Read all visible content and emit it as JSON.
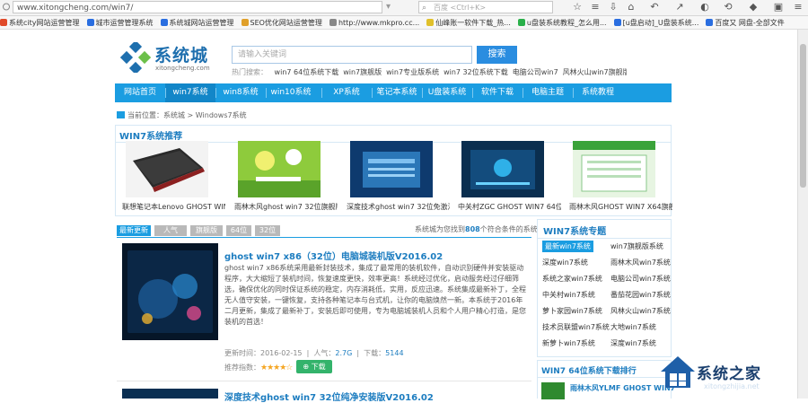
{
  "browser": {
    "url": "www.xitongcheng.com/win7/",
    "search_placeholder": "百度 <Ctrl+K>",
    "bookmarks": [
      {
        "label": "系统city网站运营管理",
        "color": "#e04a2a"
      },
      {
        "label": "城市运营管理系统",
        "color": "#2a6ee0"
      },
      {
        "label": "系统城网站运营管理",
        "color": "#2a6ee0"
      },
      {
        "label": "SEO优化网站运营管理",
        "color": "#e0a02a"
      },
      {
        "label": "http://www.mkpro.cc...",
        "color": "#888888"
      },
      {
        "label": "仙峰账一软件下载_热...",
        "color": "#e0c02a"
      },
      {
        "label": "u盘装系统教程_怎么用...",
        "color": "#2ab04a"
      },
      {
        "label": "[u盘启动]_U盘装系统...",
        "color": "#2a6ee0"
      },
      {
        "label": "百度又 网盘-全部文件",
        "color": "#2a6ee0"
      }
    ]
  },
  "header": {
    "logo_name": "系统城",
    "logo_sub": "xitongcheng.com",
    "search_placeholder": "请输入关键词",
    "search_button": "搜索",
    "hot_label": "热门搜索：",
    "hot_items": [
      "win7 64位系统下载",
      "win7旗舰版",
      "win7专业版系统",
      "win7 32位系统下载",
      "电脑公司win7",
      "风林火山win7旗舰版"
    ]
  },
  "nav": [
    "网站首页",
    "win7系统",
    "win8系统",
    "win10系统",
    "XP系统",
    "笔记本系统",
    "U盘装系统",
    "软件下载",
    "电脑主题",
    "系统教程",
    "系统教程"
  ],
  "breadcrumb": "当前位置：系统城 > Windows7系统",
  "recommend": {
    "title": "WIN7系统推荐",
    "items": [
      "联想笔记本Lenovo GHOST WIN7",
      "雨林木风ghost win7 32位旗舰版",
      "深度技术ghost win7 32位免激活版",
      "中关村ZGC GHOST WIN7 64位",
      "雨林木风GHOST WIN7 X64旗舰版"
    ]
  },
  "tabs": [
    "最新更新",
    "人气",
    "旗舰版",
    "64位",
    "32位"
  ],
  "count": {
    "prefix": "系统城为您找到",
    "number": "808",
    "suffix": "个符合条件的系统"
  },
  "article": {
    "title": "ghost win7 x86（32位）电脑城装机版V2016.02",
    "desc": "ghost win7 x86系统采用最新封装技术，集成了最常用的装机软件，自动识别硬件并安装驱动程序，大大缩短了装机时间，恢复速度更快，效率更高！系统经过优化，启动服务经过仔细筛选，确保优化的同时保证系统的稳定，内存消耗低，实用，反应迅速。系统集成最新补丁，全程无人值守安装，一键恢复，支持各种笔记本与台式机，让你的电脑焕然一新。本系统于2016年二月更新，集成了最新补丁，安装后即可使用，专为电脑城装机人员和个人用户精心打造，是您装机的首选！",
    "meta_prefix": "更新时间：",
    "date": "2016-02-15",
    "size_label": "人气：",
    "size": "2.7G",
    "downloads_label": "下载：",
    "downloads": "5144",
    "rating_label": "推荐指数：",
    "stars": "★★★★☆",
    "download_button": "下载"
  },
  "article2": {
    "title": "深度技术ghost win7 32位纯净安装版V2016.02"
  },
  "sidebar": {
    "title": "WIN7系统专题",
    "items": [
      [
        "最新win7系统",
        "win7旗舰版系统"
      ],
      [
        "深度win7系统",
        "雨林木风win7系统"
      ],
      [
        "系统之家win7系统",
        "电脑公司win7系统"
      ],
      [
        "中关村win7系统",
        "番茄花园win7系统"
      ],
      [
        "萝卜家园win7系统",
        "风林火山win7系统"
      ],
      [
        "技术员联盟win7系统",
        "大地win7系统"
      ],
      [
        "新萝卜win7系统",
        "深度win7系统"
      ]
    ]
  },
  "sidebar2": {
    "title": "WIN7 64位系统下载排行",
    "top_item": "雨林木风YLMF GHOST WIN7"
  },
  "watermark": {
    "text": "系统之家",
    "url": "xitongzhijia.net"
  }
}
